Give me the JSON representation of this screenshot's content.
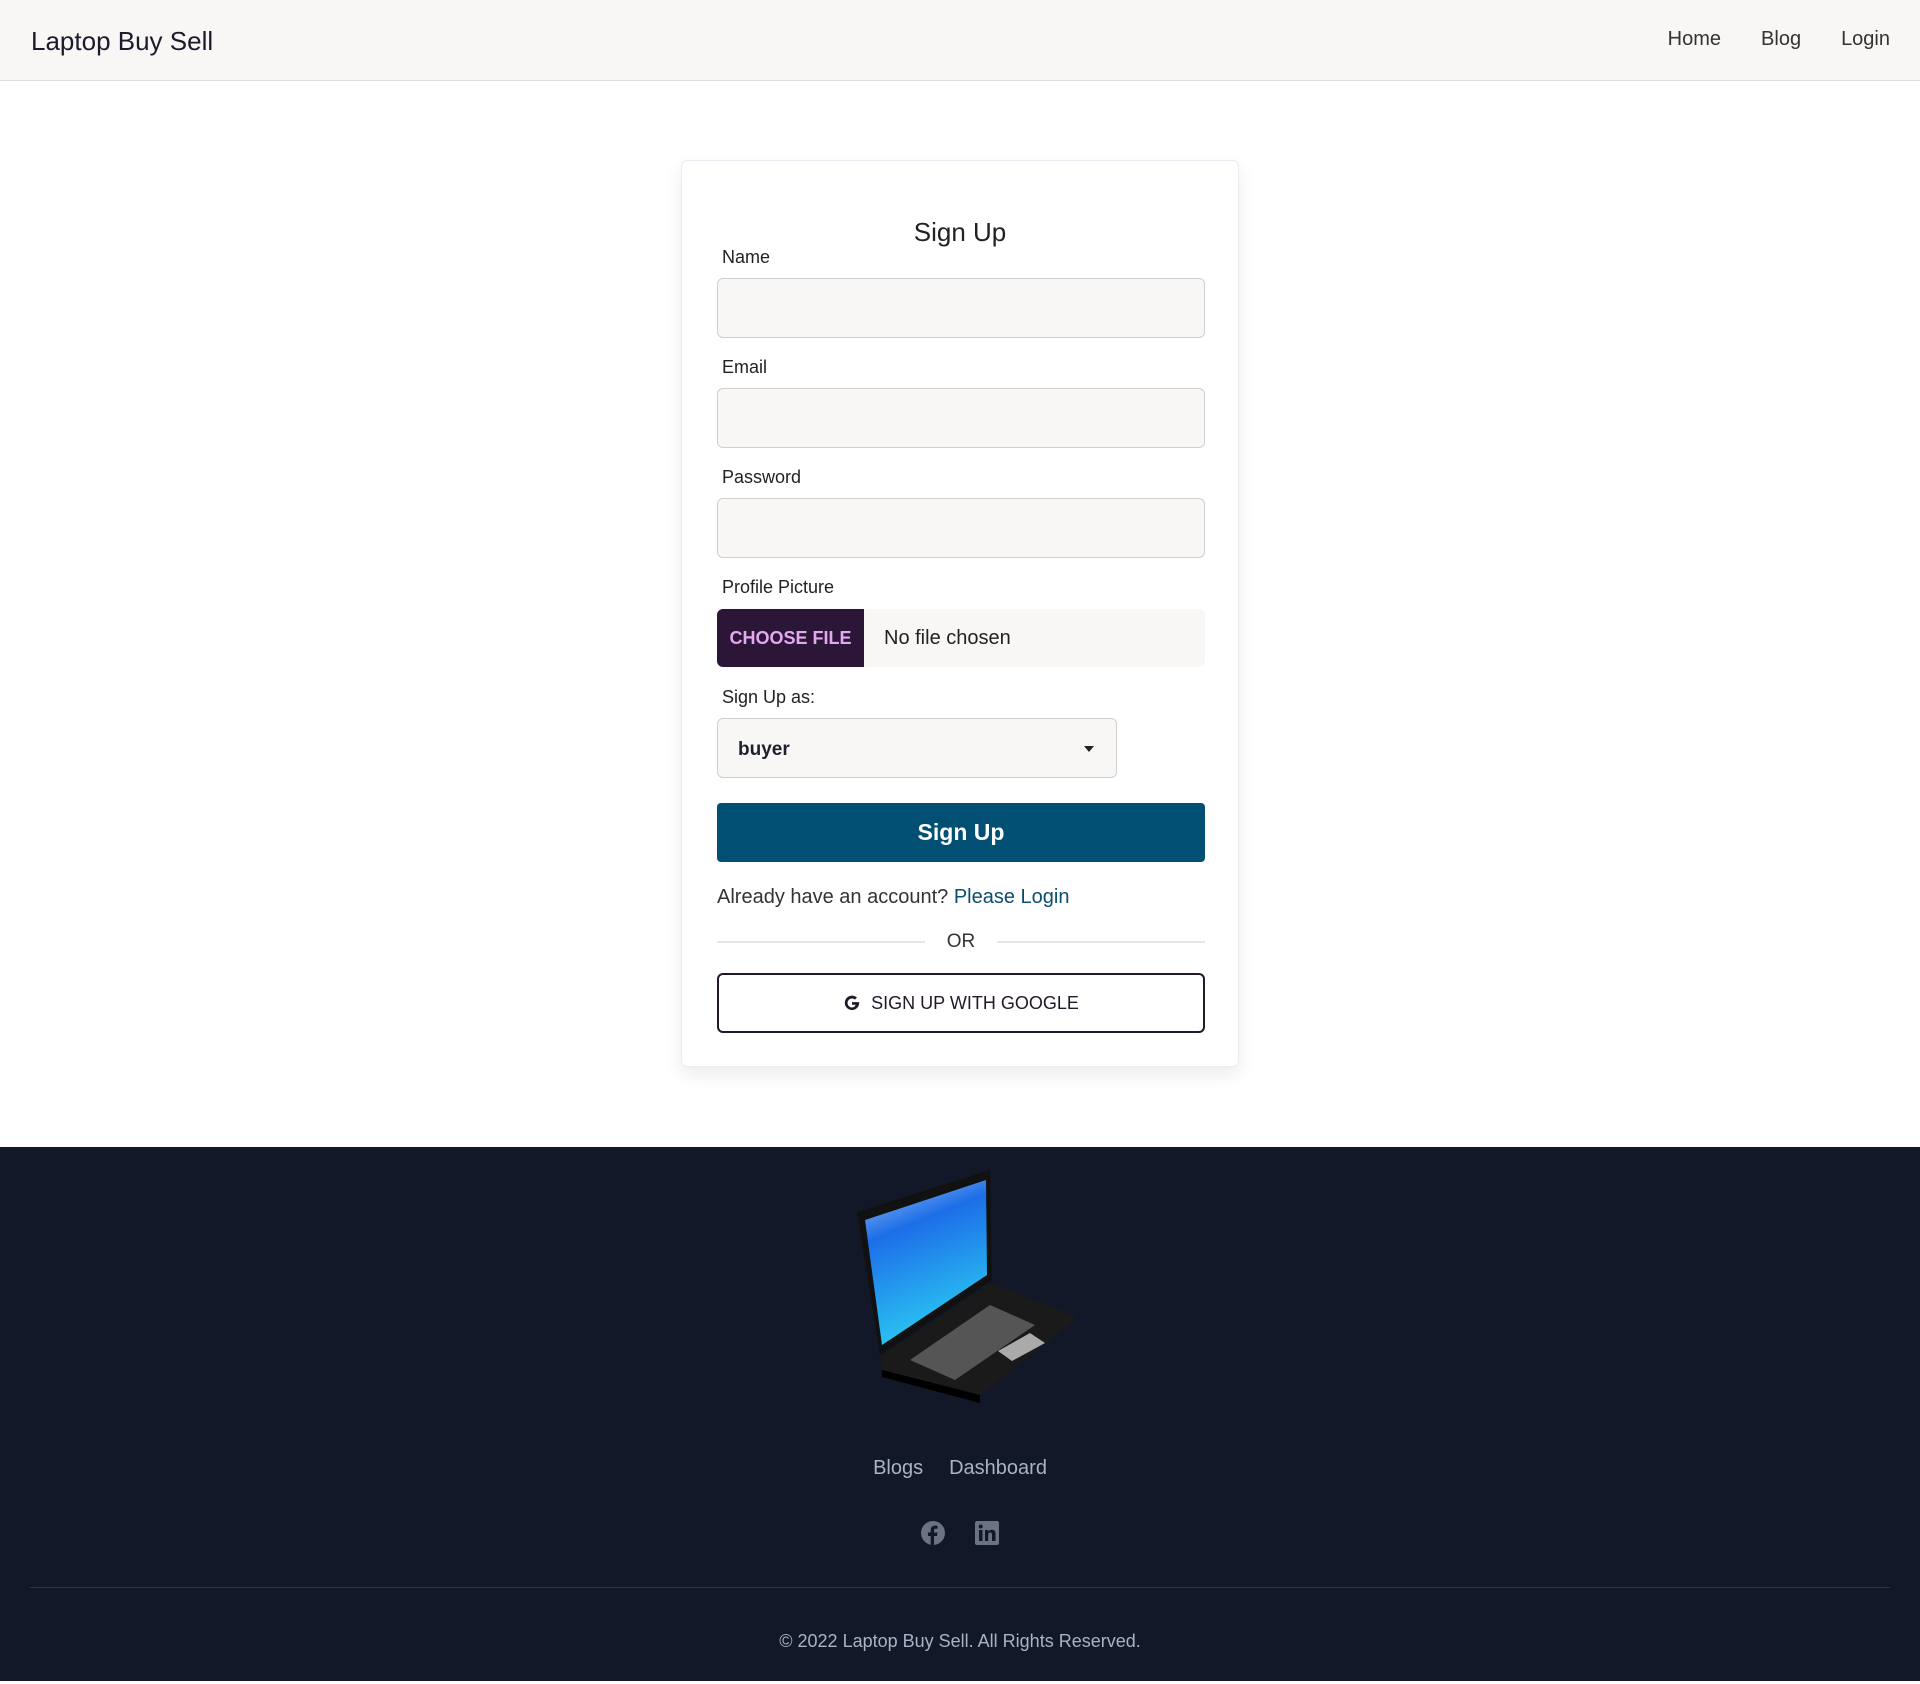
{
  "navbar": {
    "brand": "Laptop Buy Sell",
    "links": [
      "Home",
      "Blog",
      "Login"
    ]
  },
  "form": {
    "title": "Sign Up",
    "name_label": "Name",
    "name_value": "",
    "email_label": "Email",
    "email_value": "",
    "password_label": "Password",
    "password_value": "",
    "picture_label": "Profile Picture",
    "choose_file": "CHOOSE FILE",
    "no_file": "No file chosen",
    "role_label": "Sign Up as:",
    "role_value": "buyer",
    "submit": "Sign Up",
    "already": "Already have an account?",
    "login_link": "Please Login",
    "or": "OR",
    "google": "SIGN UP WITH GOOGLE"
  },
  "footer": {
    "links": [
      "Blogs",
      "Dashboard"
    ],
    "social": [
      "facebook-icon",
      "linkedin-icon"
    ],
    "copyright": "© 2022 Laptop Buy Sell. All Rights Reserved."
  },
  "colors": {
    "primary": "#024f74",
    "file_button": "#2b1638",
    "footer_bg": "#121827"
  }
}
